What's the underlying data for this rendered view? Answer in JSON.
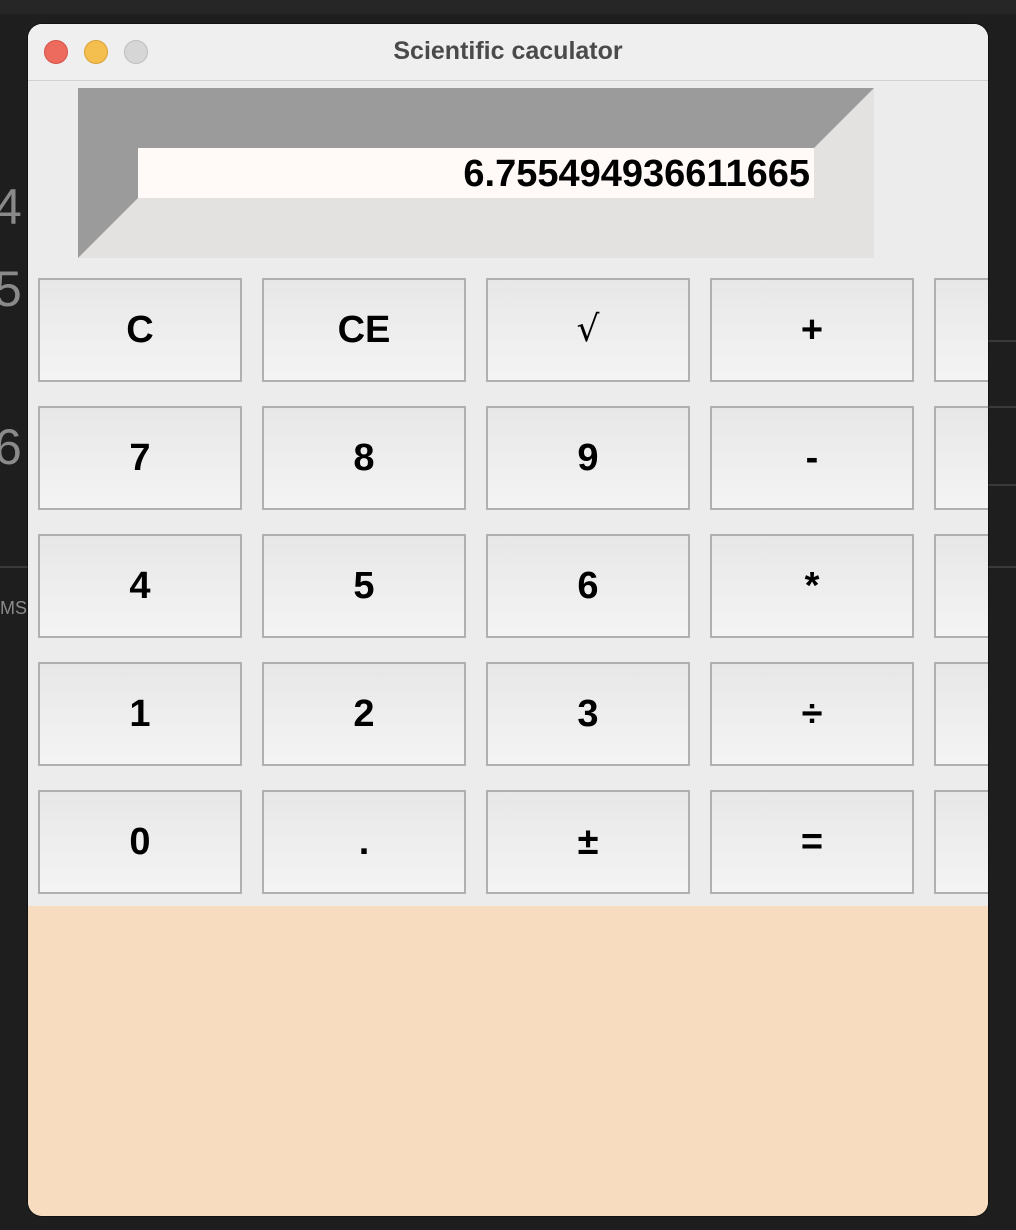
{
  "window": {
    "title": "Scientific caculator"
  },
  "display": {
    "value": "6.755494936611665"
  },
  "buttons": {
    "clear": "C",
    "clear_entry": "CE",
    "sqrt": "√",
    "plus": "+",
    "seven": "7",
    "eight": "8",
    "nine": "9",
    "minus": "-",
    "four": "4",
    "five": "5",
    "six": "6",
    "multiply": "*",
    "one": "1",
    "two": "2",
    "three": "3",
    "divide": "÷",
    "zero": "0",
    "decimal": ".",
    "plus_minus": "±",
    "equals": "="
  },
  "background": {
    "digits": [
      "4",
      "5",
      "6"
    ],
    "label": "MS"
  },
  "colors": {
    "window_bg": "#ececec",
    "bottom_panel": "#f7dcc0",
    "display_dark_bevel": "#9b9b9b",
    "display_light_bevel": "#e4e2e1",
    "display_field": "#fffaf8",
    "close": "#ed6a5e",
    "minimize": "#f5bf4f",
    "maximize": "#d6d6d6"
  }
}
